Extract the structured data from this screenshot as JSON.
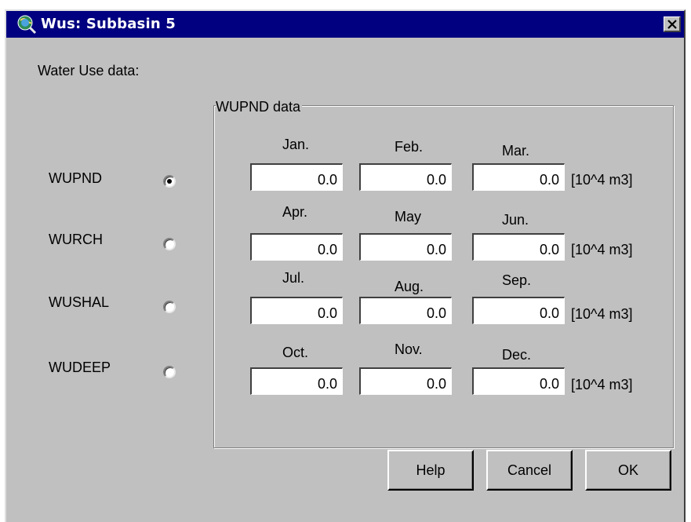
{
  "window": {
    "title": "Wus: Subbasin 5",
    "close_symbol": "✕"
  },
  "section_label": "Water Use data:",
  "options": [
    {
      "label": "WUPND",
      "selected": true
    },
    {
      "label": "WURCH",
      "selected": false
    },
    {
      "label": "WUSHAL",
      "selected": false
    },
    {
      "label": "WUDEEP",
      "selected": false
    }
  ],
  "group": {
    "label": "WUPND  data"
  },
  "months": [
    "Jan.",
    "Feb.",
    "Mar.",
    "Apr.",
    "May",
    "Jun.",
    "Jul.",
    "Aug.",
    "Sep.",
    "Oct.",
    "Nov.",
    "Dec."
  ],
  "values": [
    "0.0",
    "0.0",
    "0.0",
    "0.0",
    "0.0",
    "0.0",
    "0.0",
    "0.0",
    "0.0",
    "0.0",
    "0.0",
    "0.0"
  ],
  "unit": "[10^4 m3]",
  "buttons": {
    "help": "Help",
    "cancel": "Cancel",
    "ok": "OK"
  },
  "colors": {
    "titlebar": "#000080",
    "face": "#c0c0c0"
  },
  "icons": {
    "app": "globe-magnifier-icon",
    "close": "close-icon"
  }
}
